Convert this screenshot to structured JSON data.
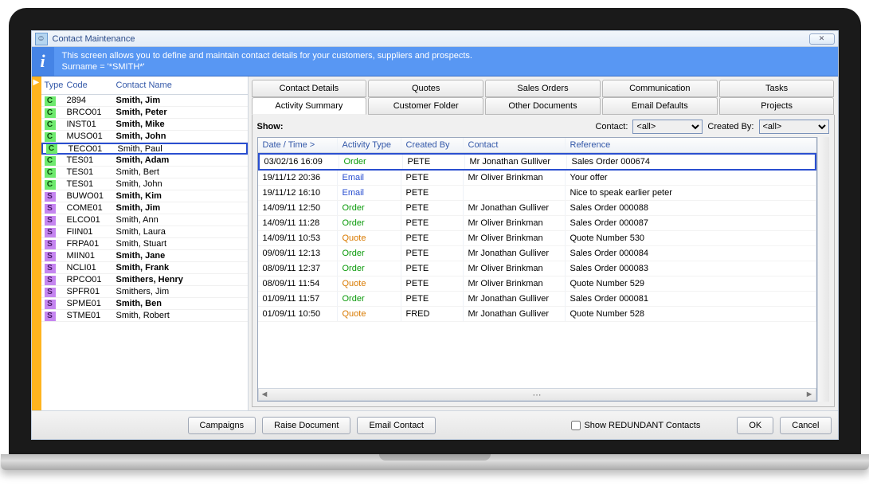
{
  "window": {
    "title": "Contact Maintenance"
  },
  "info": {
    "line1": "This screen allows you to define and maintain contact details for your customers, suppliers and prospects.",
    "line2": "Surname = '*SMITH*'"
  },
  "contacts": {
    "headers": {
      "type": "Type",
      "code": "Code",
      "name": "Contact Name"
    },
    "selectedIndex": 4,
    "rows": [
      {
        "type": "C",
        "code": "2894",
        "name": "Smith, Jim",
        "bold": true
      },
      {
        "type": "C",
        "code": "BRCO01",
        "name": "Smith, Peter",
        "bold": true
      },
      {
        "type": "C",
        "code": "INST01",
        "name": "Smith, Mike",
        "bold": true
      },
      {
        "type": "C",
        "code": "MUSO01",
        "name": "Smith, John",
        "bold": true
      },
      {
        "type": "C",
        "code": "TECO01",
        "name": "Smith, Paul",
        "bold": false
      },
      {
        "type": "C",
        "code": "TES01",
        "name": "Smith, Adam",
        "bold": true
      },
      {
        "type": "C",
        "code": "TES01",
        "name": "Smith, Bert",
        "bold": false
      },
      {
        "type": "C",
        "code": "TES01",
        "name": "Smith, John",
        "bold": false
      },
      {
        "type": "S",
        "code": "BUWO01",
        "name": "Smith, Kim",
        "bold": true
      },
      {
        "type": "S",
        "code": "COME01",
        "name": "Smith, Jim",
        "bold": true
      },
      {
        "type": "S",
        "code": "ELCO01",
        "name": "Smith, Ann",
        "bold": false
      },
      {
        "type": "S",
        "code": "FIIN01",
        "name": "Smith, Laura",
        "bold": false
      },
      {
        "type": "S",
        "code": "FRPA01",
        "name": "Smith, Stuart",
        "bold": false
      },
      {
        "type": "S",
        "code": "MIIN01",
        "name": "Smith, Jane",
        "bold": true
      },
      {
        "type": "S",
        "code": "NCLI01",
        "name": "Smith, Frank",
        "bold": true
      },
      {
        "type": "S",
        "code": "RPCO01",
        "name": "Smithers, Henry",
        "bold": true
      },
      {
        "type": "S",
        "code": "SPFR01",
        "name": "Smithers, Jim",
        "bold": false
      },
      {
        "type": "S",
        "code": "SPME01",
        "name": "Smith, Ben",
        "bold": true
      },
      {
        "type": "S",
        "code": "STME01",
        "name": "Smith, Robert",
        "bold": false
      }
    ]
  },
  "tabs": {
    "row1": [
      "Contact Details",
      "Quotes",
      "Sales Orders",
      "Communication",
      "Tasks"
    ],
    "row2": [
      "Activity Summary",
      "Customer Folder",
      "Other Documents",
      "Email Defaults",
      "Projects"
    ],
    "activeRow": 2,
    "activeIndex": 0
  },
  "activity": {
    "showLabel": "Show:",
    "contactLabel": "Contact:",
    "createdByLabel": "Created By:",
    "contactValue": "<all>",
    "createdByValue": "<all>",
    "headers": {
      "dt": "Date / Time >",
      "at": "Activity Type",
      "cb": "Created By",
      "ct": "Contact",
      "rf": "Reference"
    },
    "selectedIndex": 0,
    "rows": [
      {
        "dt": "03/02/16 16:09",
        "at": "Order",
        "cb": "PETE",
        "ct": "Mr Jonathan Gulliver",
        "rf": "Sales Order 000674"
      },
      {
        "dt": "19/11/12 20:36",
        "at": "Email",
        "cb": "PETE",
        "ct": "Mr Oliver Brinkman",
        "rf": "Your offer"
      },
      {
        "dt": "19/11/12 16:10",
        "at": "Email",
        "cb": "PETE",
        "ct": "",
        "rf": "Nice to speak earlier peter"
      },
      {
        "dt": "14/09/11 12:50",
        "at": "Order",
        "cb": "PETE",
        "ct": "Mr Jonathan Gulliver",
        "rf": "Sales Order 000088"
      },
      {
        "dt": "14/09/11 11:28",
        "at": "Order",
        "cb": "PETE",
        "ct": "Mr Oliver Brinkman",
        "rf": "Sales Order 000087"
      },
      {
        "dt": "14/09/11 10:53",
        "at": "Quote",
        "cb": "PETE",
        "ct": "Mr Oliver Brinkman",
        "rf": "Quote Number 530"
      },
      {
        "dt": "09/09/11 12:13",
        "at": "Order",
        "cb": "PETE",
        "ct": "Mr Jonathan Gulliver",
        "rf": "Sales Order 000084"
      },
      {
        "dt": "08/09/11 12:37",
        "at": "Order",
        "cb": "PETE",
        "ct": "Mr Oliver Brinkman",
        "rf": "Sales Order 000083"
      },
      {
        "dt": "08/09/11 11:54",
        "at": "Quote",
        "cb": "PETE",
        "ct": "Mr Oliver Brinkman",
        "rf": "Quote Number 529"
      },
      {
        "dt": "01/09/11 11:57",
        "at": "Order",
        "cb": "PETE",
        "ct": "Mr Jonathan Gulliver",
        "rf": "Sales Order 000081"
      },
      {
        "dt": "01/09/11 10:50",
        "at": "Quote",
        "cb": "FRED",
        "ct": "Mr Jonathan Gulliver",
        "rf": "Quote Number 528"
      }
    ]
  },
  "footer": {
    "campaigns": "Campaigns",
    "raise": "Raise Document",
    "email": "Email Contact",
    "redundant": "Show REDUNDANT Contacts",
    "ok": "OK",
    "cancel": "Cancel"
  }
}
